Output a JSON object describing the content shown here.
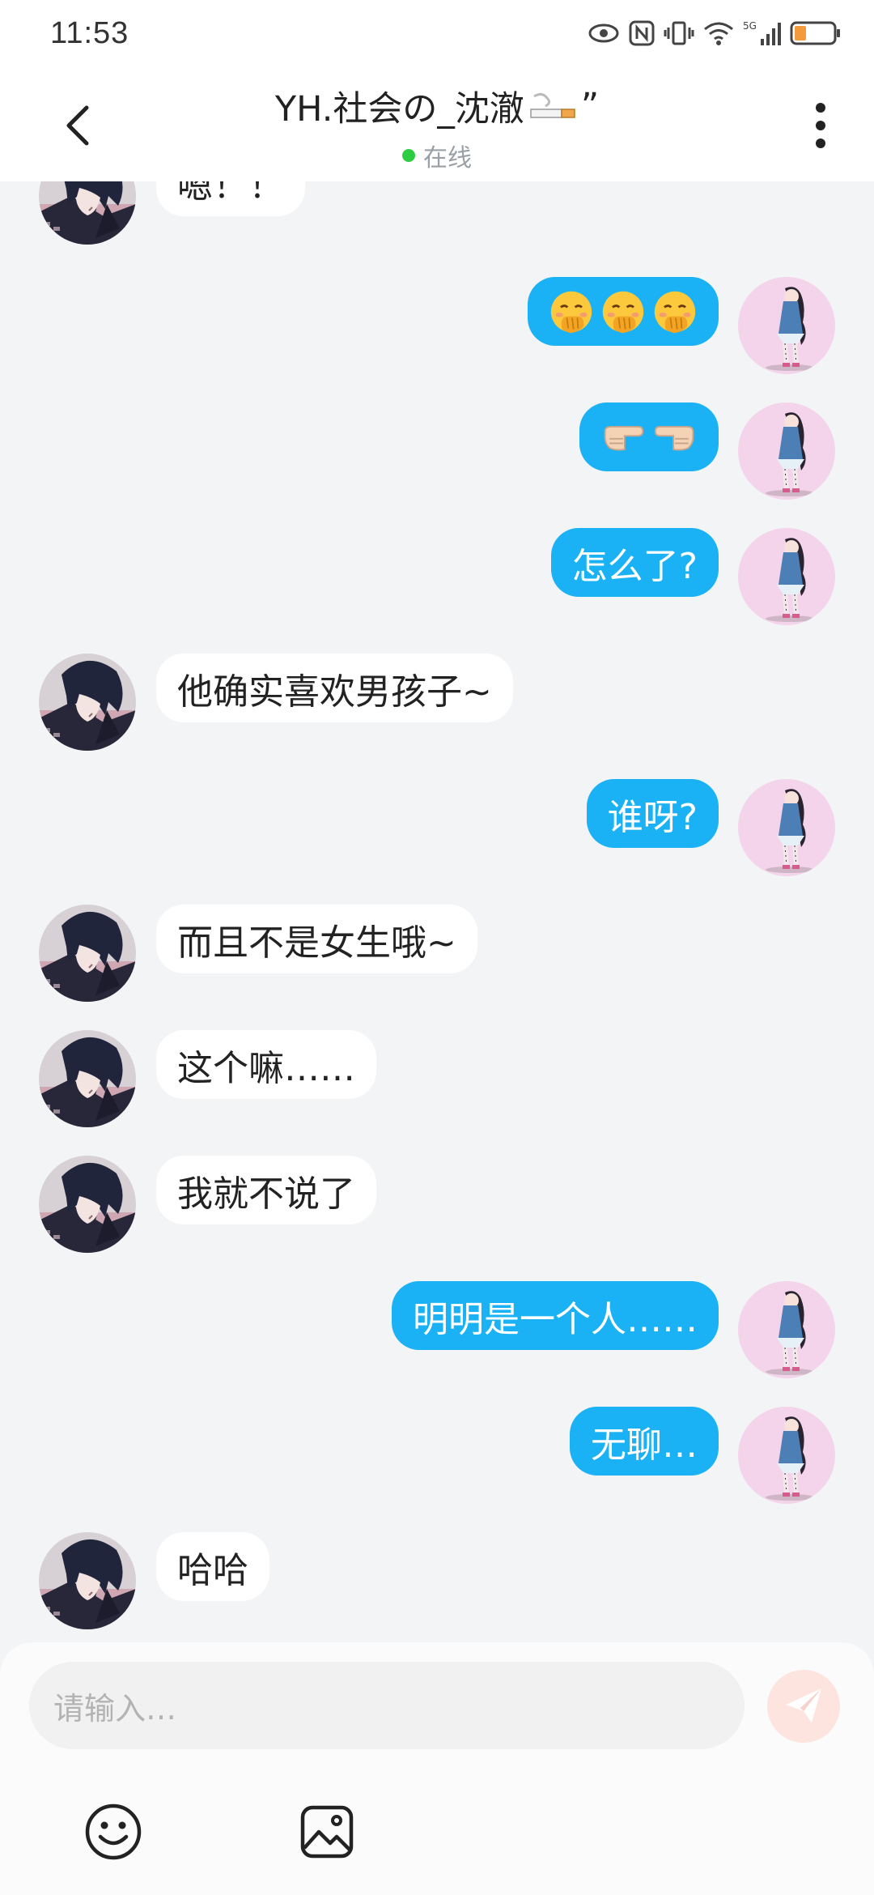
{
  "status_bar": {
    "time": "11:53",
    "battery_color": "#f39a3d"
  },
  "header": {
    "title": "YH.社会の_沈澈",
    "title_suffix": "”",
    "presence": "在线",
    "presence_color": "#2ecc40"
  },
  "messages": [
    {
      "side": "left",
      "text": "嗯！！",
      "partial": true
    },
    {
      "side": "right",
      "emoji": [
        "hand-over-mouth",
        "hand-over-mouth",
        "hand-over-mouth"
      ]
    },
    {
      "side": "right",
      "emoji": [
        "pointing-right",
        "pointing-left"
      ]
    },
    {
      "side": "right",
      "text": "怎么了?"
    },
    {
      "side": "left",
      "text": "他确实喜欢男孩子~"
    },
    {
      "side": "right",
      "text": "谁呀?"
    },
    {
      "side": "left",
      "text": "而且不是女生哦~"
    },
    {
      "side": "left",
      "text": "这个嘛……"
    },
    {
      "side": "left",
      "text": "我就不说了"
    },
    {
      "side": "right",
      "text": "明明是一个人……"
    },
    {
      "side": "right",
      "text": "无聊…"
    },
    {
      "side": "left",
      "text": "哈哈"
    }
  ],
  "input": {
    "placeholder": "请输入…"
  },
  "colors": {
    "accent": "#1ab2f4",
    "send_button": "#fde4df"
  }
}
